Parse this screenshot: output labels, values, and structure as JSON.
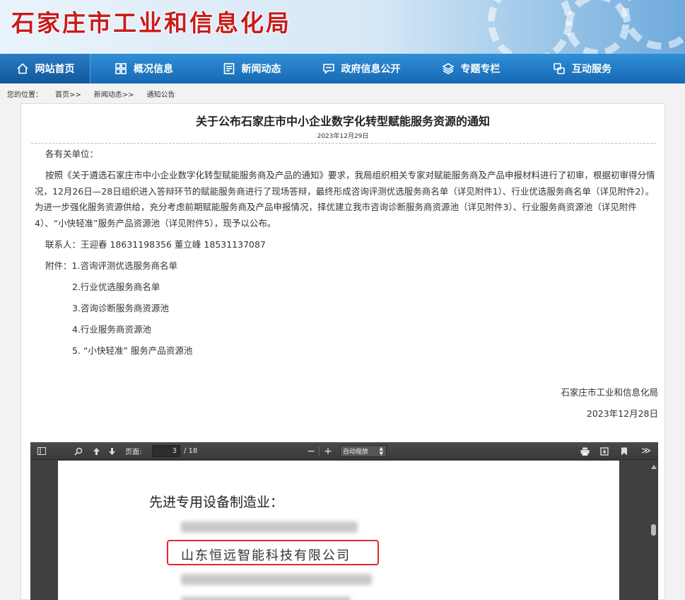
{
  "site": {
    "title": "石家庄市工业和信息化局"
  },
  "nav": {
    "items": [
      {
        "label": "网站首页",
        "icon": "home-icon"
      },
      {
        "label": "概况信息",
        "icon": "grid-icon"
      },
      {
        "label": "新闻动态",
        "icon": "newspaper-icon"
      },
      {
        "label": "政府信息公开",
        "icon": "chat-icon"
      },
      {
        "label": "专题专栏",
        "icon": "layers-icon"
      },
      {
        "label": "互动服务",
        "icon": "interact-icon"
      }
    ]
  },
  "breadcrumb": {
    "prefix": "您的位置：",
    "items": [
      "首页>>",
      "新闻动态>>",
      "通知公告"
    ]
  },
  "article": {
    "title": "关于公布石家庄市中小企业数字化转型赋能服务资源的通知",
    "date": "2023年12月29日",
    "greeting": "各有关单位：",
    "body": "按照《关于遴选石家庄市中小企业数字化转型赋能服务商及产品的通知》要求，我局组织相关专家对赋能服务商及产品申报材料进行了初审，根据初审得分情况，12月26日—28日组织进入答辩环节的赋能服务商进行了现场答辩，最终形成咨询评测优选服务商名单（详见附件1）、行业优选服务商名单（详见附件2）。为进一步强化服务资源供给，充分考虑前期赋能服务商及产品申报情况，择优建立我市咨询诊断服务商资源池（详见附件3）、行业服务商资源池（详见附件4）、“小快轻准”服务产品资源池（详见附件5），现予以公布。",
    "contacts": "联系人：王迎春 18631198356 董立峰 18531137087",
    "attachments_prefix": "附件：",
    "attachments": [
      "1.咨询评测优选服务商名单",
      "2.行业优选服务商名单",
      "3.咨询诊断服务商资源池",
      "4.行业服务商资源池",
      "5. “小快轻准” 服务产品资源池"
    ],
    "signature": "石家庄市工业和信息化局",
    "signature_date": "2023年12月28日"
  },
  "pdf": {
    "page_label": "页面:",
    "page_value": "3",
    "page_total": "/ 18",
    "zoom_label": "自动缩放",
    "category": "先进专用设备制造业：",
    "company": "山东恒远智能科技有限公司",
    "highlight_color": "#e12b2b"
  },
  "colors": {
    "nav": "#1768b3",
    "title_red": "#c81c1c"
  }
}
